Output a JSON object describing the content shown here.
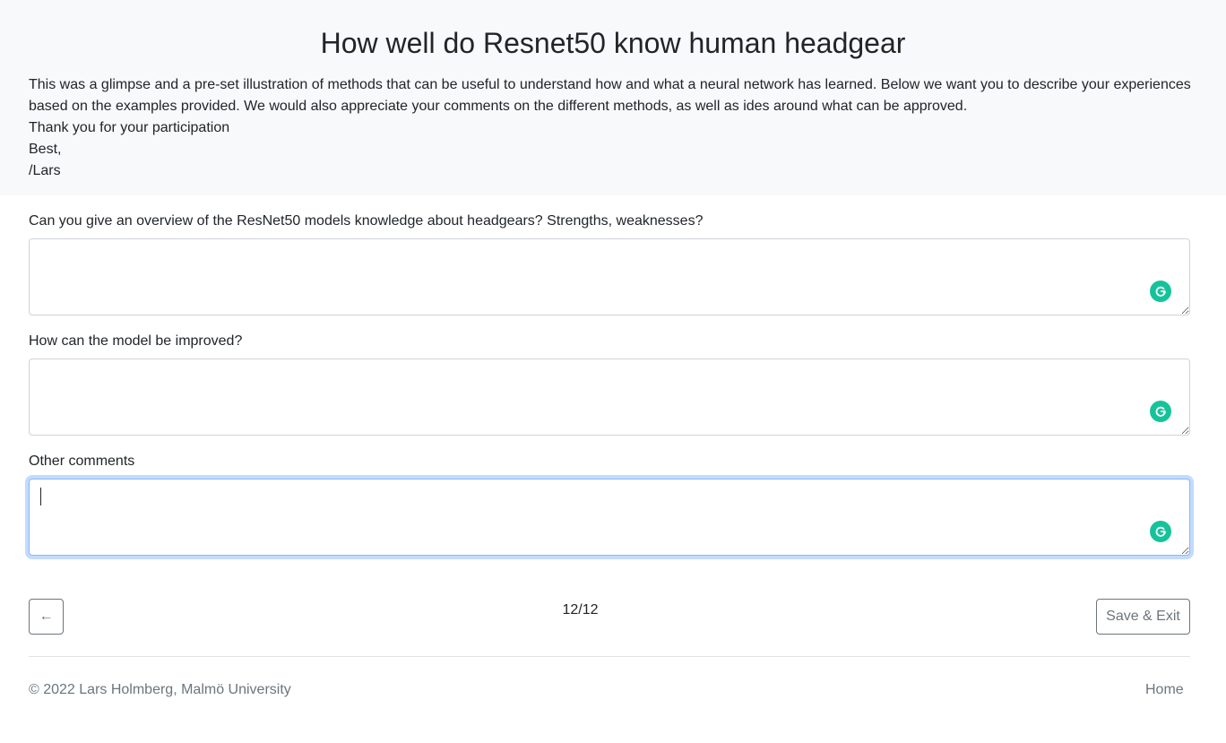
{
  "header": {
    "title": "How well do Resnet50 know human headgear",
    "intro_lines": [
      "This was a glimpse and a pre-set illustration of methods that can be useful to understand how and what a neural network has learned. Below we want you to describe your experiences based on the examples provided. We would also appreciate your comments on the different methods, as well as ides around what can be approved.",
      "Thank you for your participation",
      "Best,",
      "/Lars"
    ]
  },
  "form": {
    "questions": [
      {
        "label": "Can you give an overview of the ResNet50 models knowledge about headgears? Strengths, weaknesses?",
        "value": ""
      },
      {
        "label": "How can the model be improved?",
        "value": ""
      },
      {
        "label": "Other comments",
        "value": ""
      }
    ]
  },
  "navigation": {
    "back_label": "←",
    "page_counter": "12/12",
    "save_exit_label": "Save & Exit"
  },
  "footer": {
    "copyright": "© 2022 Lars Holmberg, Malmö University",
    "home_link": "Home"
  },
  "icons": {
    "grammarly": "grammarly-icon",
    "grammarly_color": "#15c39a"
  }
}
